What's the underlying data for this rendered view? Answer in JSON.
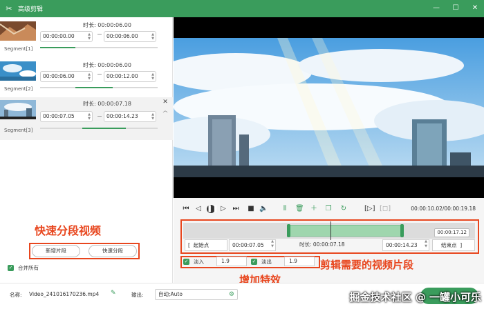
{
  "window": {
    "title": "高级剪辑"
  },
  "segments": [
    {
      "label": "Segment[1]",
      "duration": "时长: 00:00:06.00",
      "start": "00:00:00.00",
      "end": "00:00:06.00",
      "progress": 0.3
    },
    {
      "label": "Segment[2]",
      "duration": "时长: 00:00:06.00",
      "start": "00:00:06.00",
      "end": "00:00:12.00",
      "progress": 0.4
    },
    {
      "label": "Segment[3]",
      "duration": "时长: 00:00:07.18",
      "start": "00:00:07.05",
      "end": "00:00:14.23",
      "progress": 0.5
    }
  ],
  "left_buttons": {
    "add": "新增片段",
    "quick": "快速分段"
  },
  "merge_all": "合并所有",
  "annotations": {
    "quick_split": "快速分段视频",
    "clip_needed": "剪辑需要的视频片段",
    "effects": "增加特效"
  },
  "player": {
    "timecode": "00:00:10.02/00:00:19.18",
    "playhead_tip": "00:00:17.12",
    "start_btn": "起始点",
    "start_value": "00:00:07.05",
    "duration": "时长: 00:00:07.18",
    "end_value": "00:00:14.23",
    "end_btn": "结束点",
    "fade_in_label": "淡入",
    "fade_in_value": "1.9",
    "fade_out_label": "淡出",
    "fade_out_value": "1.9"
  },
  "footer": {
    "name_label": "名称:",
    "name_value": "Video_241016170236.mp4",
    "output_label": "输出:",
    "output_value": "自动;Auto"
  },
  "watermark": "掘金技术社区 @ 一罐小可乐",
  "colors": {
    "accent": "#3a9c5c",
    "annotation": "#e8461e"
  }
}
